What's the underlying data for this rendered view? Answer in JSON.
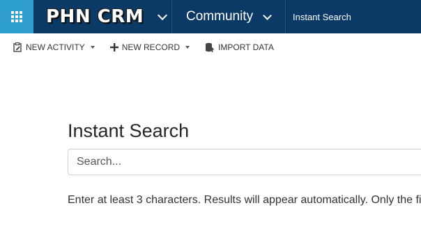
{
  "header": {
    "app_name": "PHN CRM",
    "area_label": "Community",
    "breadcrumb": "Instant Search",
    "colors": {
      "nav_background": "#0b3a66",
      "waffle_background": "#2f9fd0"
    }
  },
  "commands": {
    "new_activity": "NEW ACTIVITY",
    "new_record": "NEW RECORD",
    "import_data": "IMPORT DATA"
  },
  "icons": {
    "waffle": "app-launcher-icon",
    "new_activity": "clipboard-edit-icon",
    "new_record": "plus-icon",
    "import_data": "database-import-icon"
  },
  "main": {
    "title": "Instant Search",
    "search_placeholder": "Search...",
    "hint": "Enter at least 3 characters. Results will appear automatically. Only the fi"
  }
}
